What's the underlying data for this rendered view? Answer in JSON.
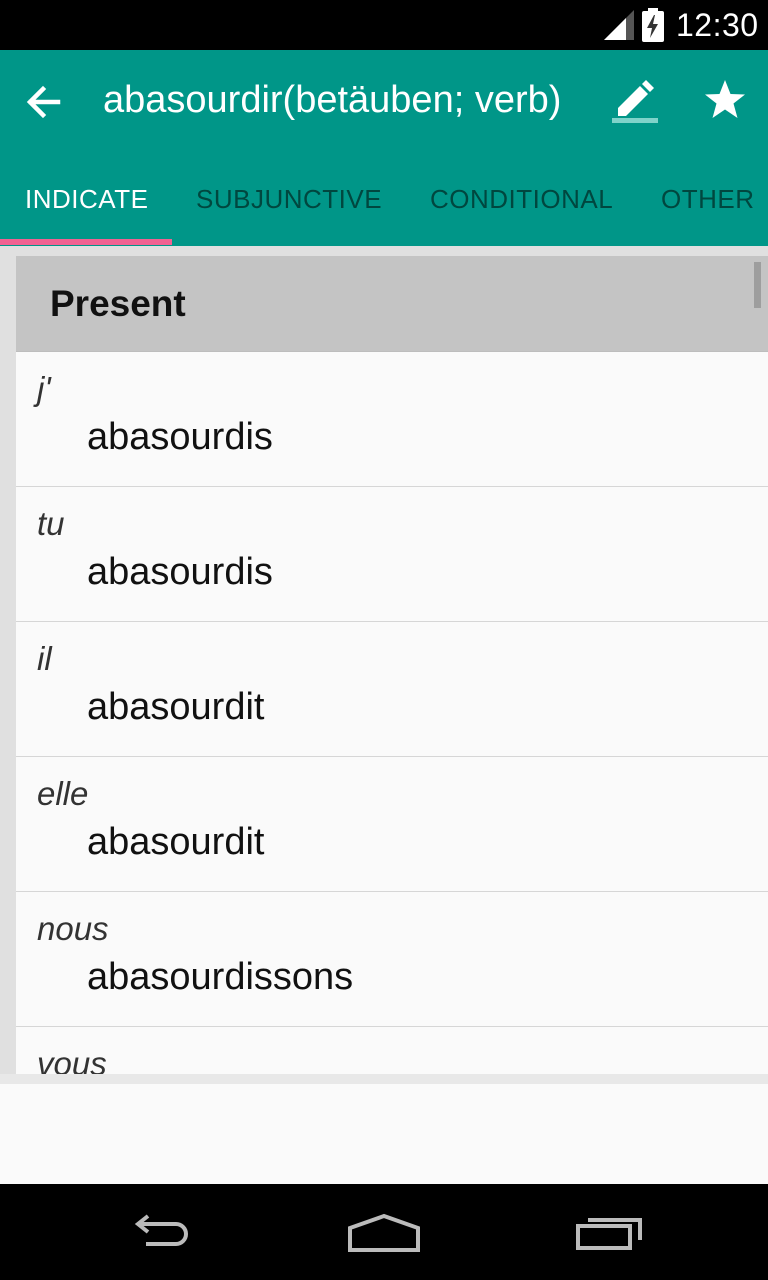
{
  "status_bar": {
    "time": "12:30",
    "icons": [
      "signal-icon",
      "battery-charging-icon"
    ]
  },
  "app_bar": {
    "title": "abasourdir(betäuben; verb)",
    "back_icon": "arrow-back-icon",
    "edit_icon": "pencil-icon",
    "star_icon": "star-icon",
    "color": "#009688"
  },
  "tabs": [
    {
      "label": "INDICATE",
      "active": true
    },
    {
      "label": "SUBJUNCTIVE",
      "active": false
    },
    {
      "label": "CONDITIONAL",
      "active": false
    },
    {
      "label": "OTHER",
      "active": false
    }
  ],
  "tab_indicator_color": "#f06292",
  "section": {
    "title": "Present"
  },
  "conjugations": [
    {
      "pronoun": "j'",
      "form": "abasourdis"
    },
    {
      "pronoun": "tu",
      "form": "abasourdis"
    },
    {
      "pronoun": "il",
      "form": "abasourdit"
    },
    {
      "pronoun": "elle",
      "form": "abasourdit"
    },
    {
      "pronoun": "nous",
      "form": "abasourdissons"
    },
    {
      "pronoun": "vous",
      "form": ""
    }
  ],
  "nav_bar": {
    "icons": [
      "back-nav-icon",
      "home-nav-icon",
      "recents-nav-icon"
    ]
  }
}
